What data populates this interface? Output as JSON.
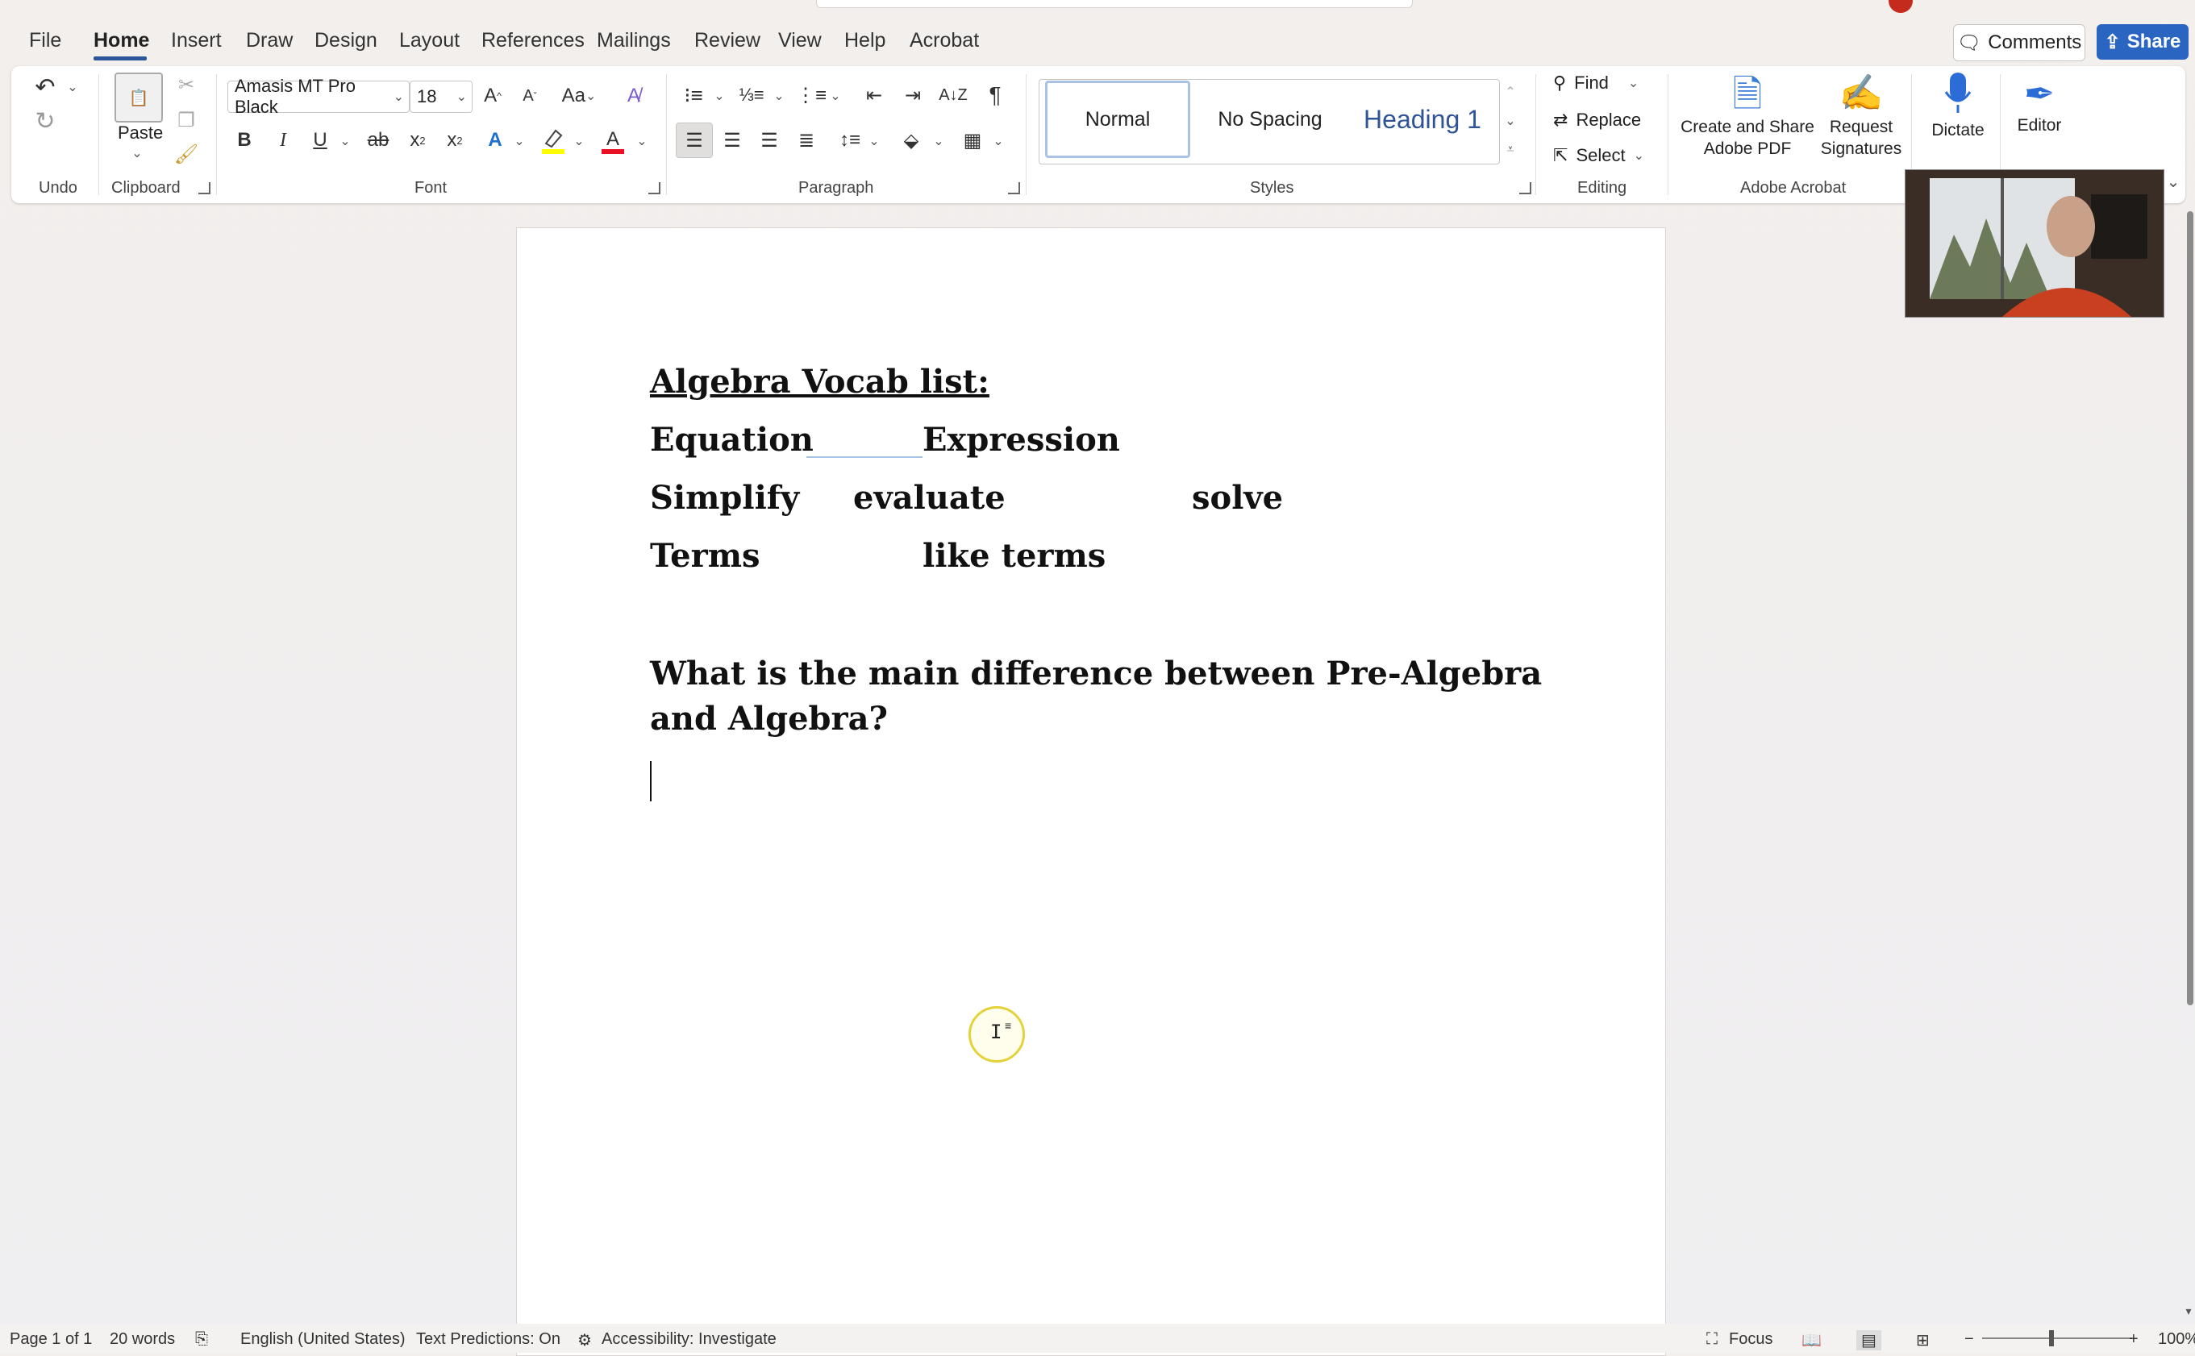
{
  "tabs": [
    "File",
    "Home",
    "Insert",
    "Draw",
    "Design",
    "Layout",
    "References",
    "Mailings",
    "Review",
    "View",
    "Help",
    "Acrobat"
  ],
  "header": {
    "comments_label": "Comments",
    "share_label": "Share"
  },
  "ribbon": {
    "undo_group": "Undo",
    "clipboard_group": "Clipboard",
    "paste_label": "Paste",
    "font_group": "Font",
    "font_name": "Amasis MT Pro Black",
    "font_size": "18",
    "paragraph_group": "Paragraph",
    "styles_group": "Styles",
    "styles": [
      "Normal",
      "No Spacing",
      "Heading 1"
    ],
    "editing_group": "Editing",
    "find_label": "Find",
    "replace_label": "Replace",
    "select_label": "Select",
    "acrobat_group": "Adobe Acrobat",
    "create_share_label": "Create and Share",
    "adobe_pdf_label": "Adobe PDF",
    "request_label": "Request",
    "signatures_label": "Signatures",
    "dictate_label": "Dictate",
    "editor_label": "Editor",
    "font_color": "#e81123",
    "highlight_color": "#ffff00",
    "accent_color": "#2b579a"
  },
  "document": {
    "title": "Algebra Vocab list:",
    "row1": [
      "Equation",
      "Expression"
    ],
    "row2": [
      "Simplify",
      "evaluate",
      "solve"
    ],
    "row3": [
      "Terms",
      "like terms"
    ],
    "question_line1": "What is the main difference between Pre-Algebra",
    "question_line2": "and Algebra?"
  },
  "status": {
    "page": "Page 1 of 1",
    "words": "20 words",
    "language": "English (United States)",
    "predictions": "Text Predictions: On",
    "accessibility": "Accessibility: Investigate",
    "focus": "Focus",
    "zoom": "100%"
  }
}
